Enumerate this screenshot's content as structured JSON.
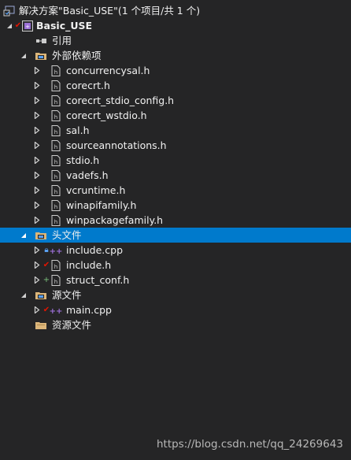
{
  "solution": {
    "title": "解决方案\"Basic_USE\"(1 个项目/共 1 个)"
  },
  "project": {
    "name": "Basic_USE"
  },
  "references": {
    "label": "引用"
  },
  "external_deps": {
    "label": "外部依赖项",
    "files": [
      "concurrencysal.h",
      "corecrt.h",
      "corecrt_stdio_config.h",
      "corecrt_wstdio.h",
      "sal.h",
      "sourceannotations.h",
      "stdio.h",
      "vadefs.h",
      "vcruntime.h",
      "winapifamily.h",
      "winpackagefamily.h"
    ]
  },
  "header_files": {
    "label": "头文件",
    "files": [
      "include.cpp",
      "include.h",
      "struct_conf.h"
    ]
  },
  "source_files": {
    "label": "源文件",
    "files": [
      "main.cpp"
    ]
  },
  "resource_files": {
    "label": "资源文件"
  },
  "watermark": "https://blog.csdn.net/qq_24269643",
  "colors": {
    "background": "#252526",
    "selection": "#007acc",
    "text": "#f1f1f1",
    "check_red": "#e51400",
    "add_green": "#7cc07c",
    "lock_blue": "#5aa0f0",
    "folder": "#dcb67a"
  }
}
